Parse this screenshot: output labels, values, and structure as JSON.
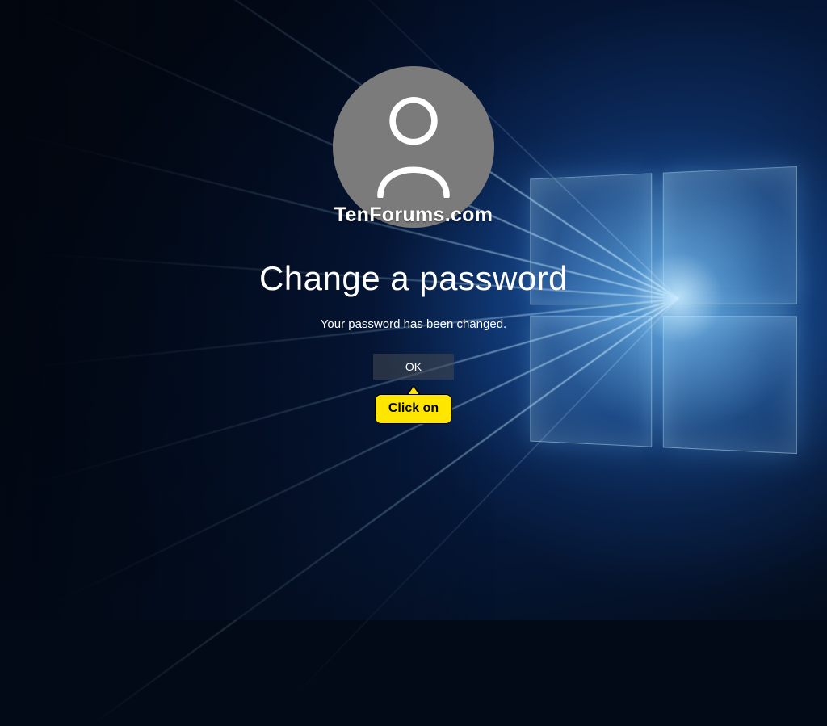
{
  "watermark": "TenForums.com",
  "dialog": {
    "title": "Change a password",
    "message": "Your password has been changed.",
    "ok_label": "OK"
  },
  "annotation": {
    "callout_text": "Click on"
  },
  "icons": {
    "avatar": "user-icon"
  },
  "colors": {
    "callout_bg": "#ffe600",
    "avatar_bg": "#7b7b7b"
  }
}
